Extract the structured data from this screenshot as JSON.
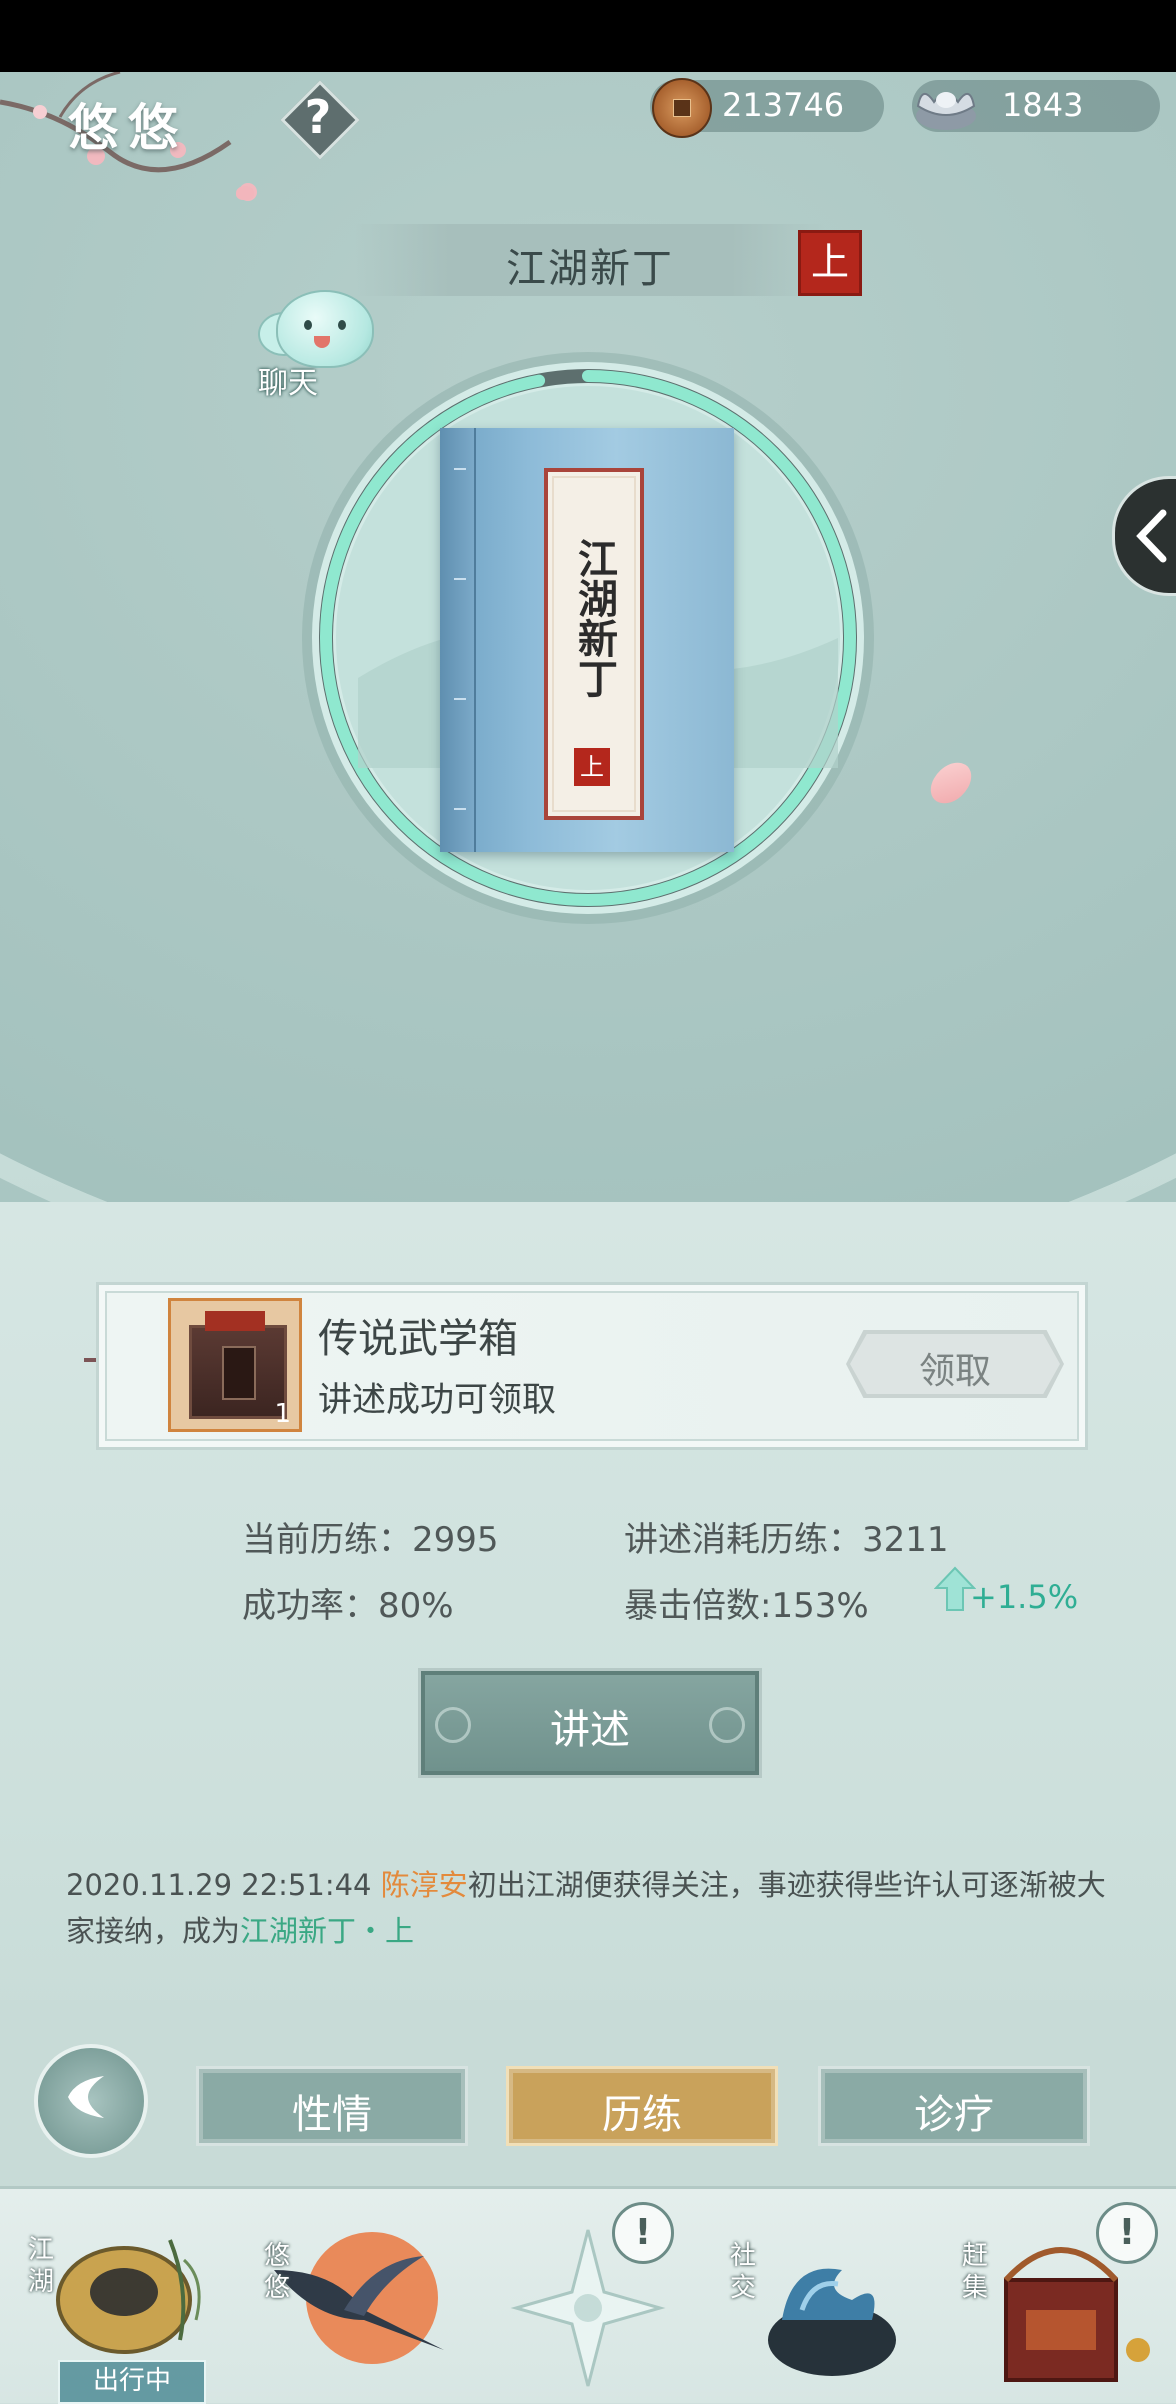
{
  "header": {
    "player_name": "悠悠",
    "help_label": "?",
    "copper_amount": "213746",
    "silver_amount": "1843"
  },
  "title": {
    "name": "江湖新丁",
    "seal": "上"
  },
  "chat": {
    "label": "聊天"
  },
  "book": {
    "cover_text": "江湖新丁",
    "seal": "上",
    "progress": 0.97
  },
  "reward": {
    "name": "传说武学箱",
    "description": "讲述成功可领取",
    "count": "1",
    "claim_label": "领取"
  },
  "stats": {
    "current_exp": "当前历练：2995",
    "cost_exp": "讲述消耗历练：3211",
    "success_rate": "成功率：80%",
    "crit_multiplier": "暴击倍数:153%",
    "bonus": "+1.5%"
  },
  "tell_button": "讲述",
  "log": {
    "timestamp": "2020.11.29 22:51:44",
    "name": "陈淳安",
    "text1": "初出江湖便获得关注，事迹获得些许认可逐渐被大家接纳，成为",
    "title": "江湖新丁・上"
  },
  "tabs": [
    {
      "label": "性情",
      "active": false
    },
    {
      "label": "历练",
      "active": true
    },
    {
      "label": "诊疗",
      "active": false
    }
  ],
  "bottom_nav": {
    "jianghu": "江湖",
    "jianghu_status": "出行中",
    "youyou": "悠悠",
    "social": "社交",
    "market": "赶集",
    "alert": "!"
  },
  "colors": {
    "accent_green": "#3aa884",
    "accent_orange": "#e38a3c",
    "tab_active": "#c9a25b",
    "seal_red": "#b4271c"
  }
}
